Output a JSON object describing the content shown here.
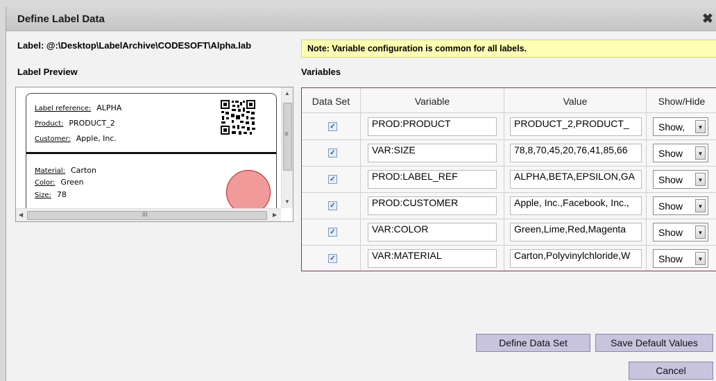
{
  "dialog": {
    "title": "Define Label Data",
    "close_glyph": "✖",
    "label_path": "Label: @:\\Desktop\\LabelArchive\\CODESOFT\\Alpha.lab",
    "note": "Note: Variable configuration is common for all labels.",
    "preview_heading": "Label Preview",
    "variables_heading": "Variables"
  },
  "preview": {
    "fields": [
      {
        "key": "Label reference:",
        "value": "ALPHA"
      },
      {
        "key": "Product:",
        "value": "PRODUCT_2"
      },
      {
        "key": "Customer:",
        "value": "Apple, Inc."
      },
      {
        "key": "Material:",
        "value": "Carton"
      },
      {
        "key": "Color:",
        "value": "Green"
      },
      {
        "key": "Size:",
        "value": "78"
      }
    ],
    "scroll": {
      "up": "▲",
      "down": "▼",
      "left": "◀",
      "right": "▶",
      "grip_v": "≡",
      "grip_h": "III"
    }
  },
  "table": {
    "headers": [
      "Data Set",
      "Variable",
      "Value",
      "Show/Hide"
    ],
    "check_glyph": "✓",
    "dropdown_glyph": "▼",
    "rows": [
      {
        "variable": "PROD:PRODUCT",
        "value": "PRODUCT_2,PRODUCT_",
        "show": "Show,"
      },
      {
        "variable": "VAR:SIZE",
        "value": "78,8,70,45,20,76,41,85,66",
        "show": "Show"
      },
      {
        "variable": "PROD:LABEL_REF",
        "value": "ALPHA,BETA,EPSILON,GA",
        "show": "Show"
      },
      {
        "variable": "PROD:CUSTOMER",
        "value": "Apple, Inc.,Facebook, Inc.,",
        "show": "Show"
      },
      {
        "variable": "VAR:COLOR",
        "value": "Green,Lime,Red,Magenta",
        "show": "Show"
      },
      {
        "variable": "VAR:MATERIAL",
        "value": "Carton,Polyvinylchloride,W",
        "show": "Show"
      }
    ]
  },
  "buttons": {
    "define_data_set": "Define Data Set",
    "save_default_values": "Save Default Values",
    "cancel": "Cancel"
  },
  "colors": {
    "table_border": "#8e2d5c",
    "button_bg": "#c9c4de",
    "note_bg": "#ffffb3",
    "red_circle": "#f19a9a"
  }
}
